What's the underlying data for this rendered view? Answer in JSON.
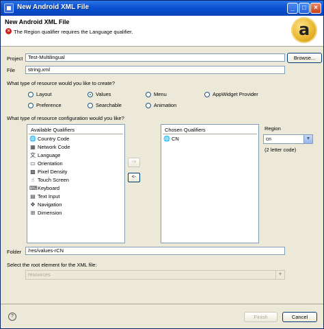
{
  "window": {
    "title": "New Android XML File"
  },
  "header": {
    "title": "New Android XML File",
    "error_message": "The Region qualifier requires the Language qualifier."
  },
  "project": {
    "label": "Project",
    "value": "Test-Multilingual",
    "browse_label": "Browse..."
  },
  "file": {
    "label": "File",
    "value": "string.xml"
  },
  "resource_type": {
    "question": "What type of resource would you like to create?",
    "options": [
      {
        "label": "Layout",
        "selected": false
      },
      {
        "label": "Values",
        "selected": true
      },
      {
        "label": "Menu",
        "selected": false
      },
      {
        "label": "AppWidget Provider",
        "selected": false
      },
      {
        "label": "Preference",
        "selected": false
      },
      {
        "label": "Searchable",
        "selected": false
      },
      {
        "label": "Animation",
        "selected": false
      }
    ]
  },
  "configuration": {
    "question": "What type of resource configuration would you like?",
    "available_header": "Available Qualifiers",
    "available": [
      {
        "label": "Country Code",
        "icon": "globe-icon"
      },
      {
        "label": "Network Code",
        "icon": "network-icon"
      },
      {
        "label": "Language",
        "icon": "language-icon"
      },
      {
        "label": "Orientation",
        "icon": "orientation-icon"
      },
      {
        "label": "Pixel Density",
        "icon": "density-icon"
      },
      {
        "label": "Touch Screen",
        "icon": "touch-icon"
      },
      {
        "label": "Keyboard",
        "icon": "keyboard-icon"
      },
      {
        "label": "Text Input",
        "icon": "text-input-icon"
      },
      {
        "label": "Navigation",
        "icon": "navigation-icon"
      },
      {
        "label": "Dimension",
        "icon": "dimension-icon"
      }
    ],
    "add_label": "->",
    "remove_label": "<-",
    "chosen_header": "Chosen Qualifiers",
    "chosen": [
      {
        "label": "CN",
        "icon": "globe-icon"
      }
    ],
    "region_label": "Region",
    "region_value": "cn",
    "region_hint": "(2 letter code)"
  },
  "folder": {
    "label": "Folder",
    "value": "/res/values-rCN"
  },
  "root_element": {
    "question": "Select the root element for the XML file:",
    "value": "resources"
  },
  "footer": {
    "finish_label": "Finish",
    "cancel_label": "Cancel"
  }
}
